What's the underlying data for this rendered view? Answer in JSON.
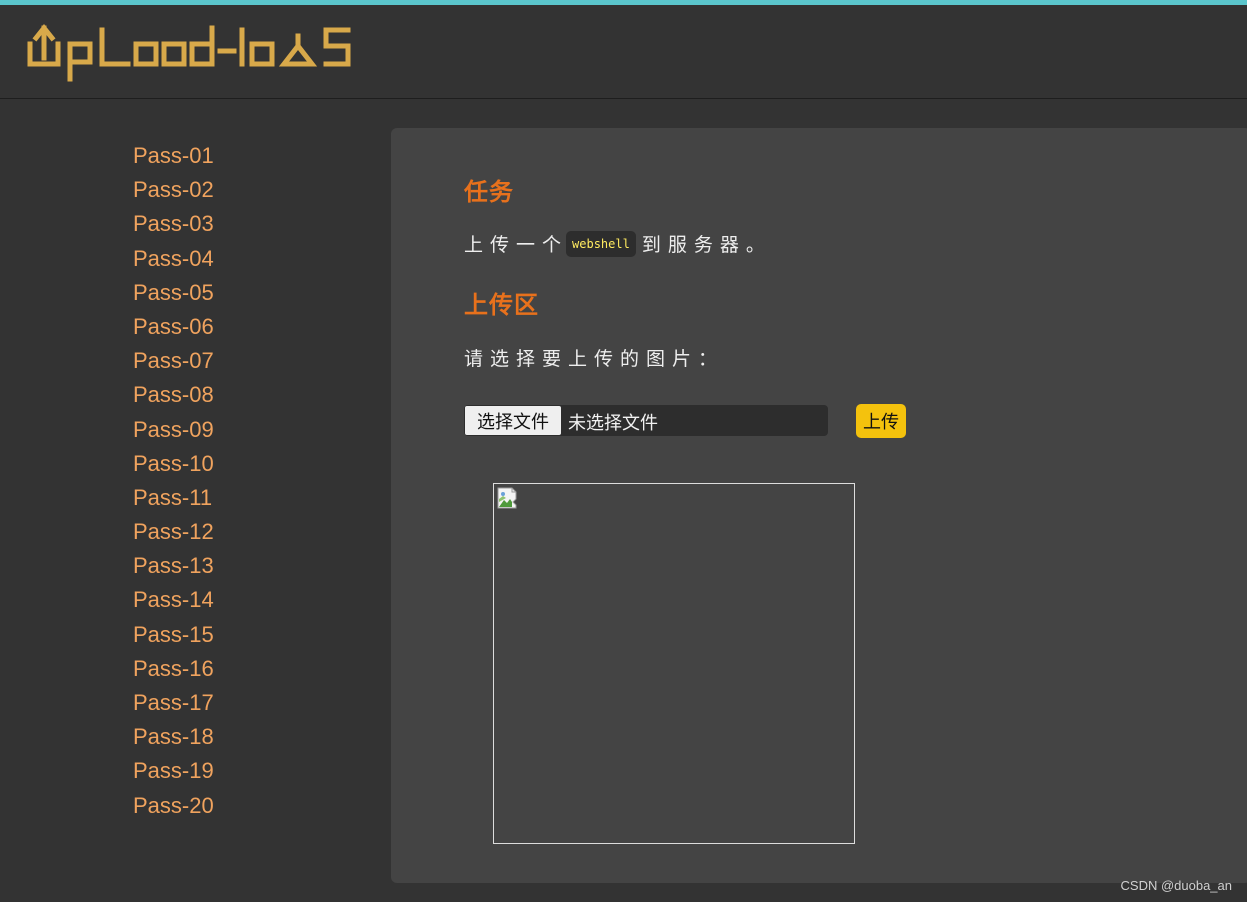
{
  "header": {
    "logo_text": "Upload-labs",
    "accent_color": "#5bc6cc",
    "logo_color": "#d8a94a"
  },
  "sidebar": {
    "items": [
      {
        "label": "Pass-01"
      },
      {
        "label": "Pass-02"
      },
      {
        "label": "Pass-03"
      },
      {
        "label": "Pass-04"
      },
      {
        "label": "Pass-05"
      },
      {
        "label": "Pass-06"
      },
      {
        "label": "Pass-07"
      },
      {
        "label": "Pass-08"
      },
      {
        "label": "Pass-09"
      },
      {
        "label": "Pass-10"
      },
      {
        "label": "Pass-11"
      },
      {
        "label": "Pass-12"
      },
      {
        "label": "Pass-13"
      },
      {
        "label": "Pass-14"
      },
      {
        "label": "Pass-15"
      },
      {
        "label": "Pass-16"
      },
      {
        "label": "Pass-17"
      },
      {
        "label": "Pass-18"
      },
      {
        "label": "Pass-19"
      },
      {
        "label": "Pass-20"
      }
    ]
  },
  "task": {
    "title": "任务",
    "text_before": "上传一个",
    "code": "webshell",
    "text_after": "到服务器。"
  },
  "upload": {
    "title": "上传区",
    "prompt": "请选择要上传的图片：",
    "choose_button": "选择文件",
    "file_status": "未选择文件",
    "submit_button": "上传"
  },
  "preview": {
    "icon": "broken-image-icon"
  },
  "watermark": "CSDN @duoba_an",
  "colors": {
    "nav_link": "#f0a35e",
    "section_title": "#e8711c",
    "upload_button": "#f4c20d",
    "code_text": "#ffeb60"
  }
}
